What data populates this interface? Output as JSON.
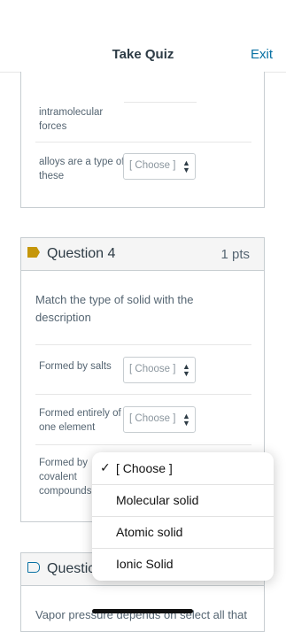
{
  "header": {
    "title": "Take Quiz",
    "exit_label": "Exit"
  },
  "question3": {
    "rows": [
      {
        "label_lines": [
          "intramolecular",
          "forces"
        ]
      },
      {
        "label_lines": [
          "alloys are a type of",
          "these"
        ],
        "select_value": "[ Choose ]"
      }
    ]
  },
  "question4": {
    "title": "Question 4",
    "points": "1 pts",
    "prompt_lines": [
      "Match the type of solid with the",
      "description"
    ],
    "rows": [
      {
        "label_lines": [
          "Formed by salts"
        ],
        "select_value": "[ Choose ]"
      },
      {
        "label_lines": [
          "Formed entirely of",
          "one element"
        ],
        "select_value": "[ Choose ]"
      },
      {
        "label_lines": [
          "Formed by",
          "covalent",
          "compounds"
        ]
      }
    ]
  },
  "dropdown": {
    "options": [
      {
        "label": "[ Choose ]",
        "selected": true,
        "check": "✓"
      },
      {
        "label": "Molecular solid"
      },
      {
        "label": "Atomic solid"
      },
      {
        "label": "Ionic Solid"
      }
    ]
  },
  "question5": {
    "title_partial": "Questic",
    "prompt_partial": "Vapor pressure depends on select all that"
  },
  "colors": {
    "accent": "#0770a3",
    "flag": "#c5960a",
    "border": "#c7cdd1"
  }
}
